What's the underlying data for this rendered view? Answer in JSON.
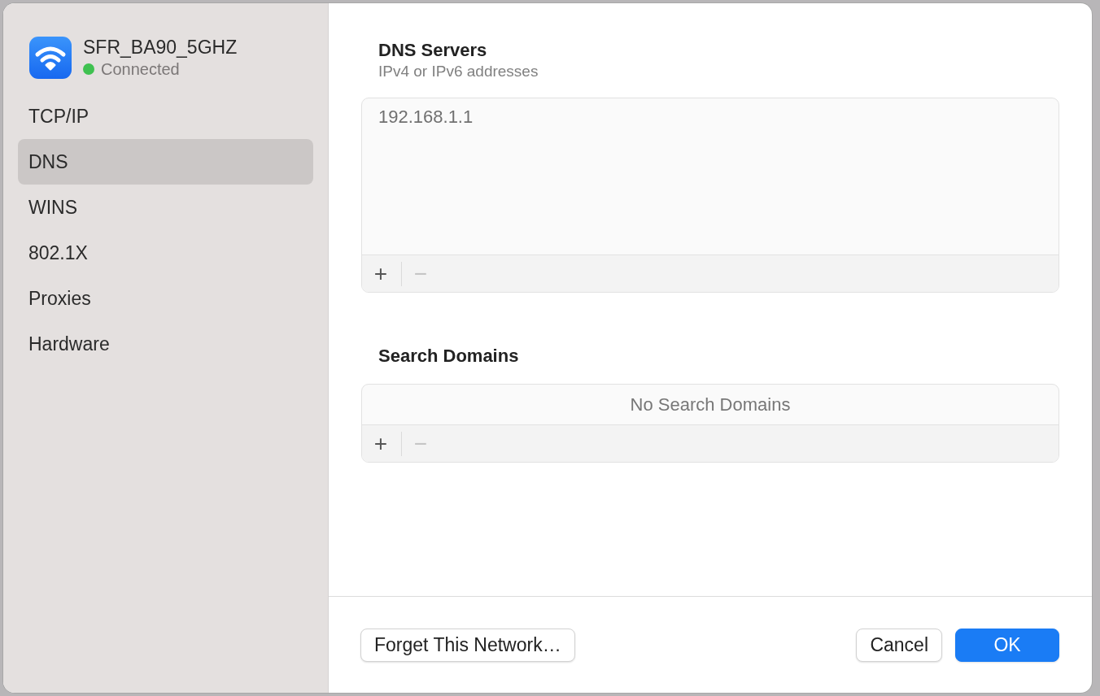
{
  "network": {
    "name": "SFR_BA90_5GHZ",
    "status": {
      "text": "Connected",
      "color": "#3fc150"
    }
  },
  "sidebar": {
    "items": [
      {
        "label": "TCP/IP",
        "selected": false
      },
      {
        "label": "DNS",
        "selected": true
      },
      {
        "label": "WINS",
        "selected": false
      },
      {
        "label": "802.1X",
        "selected": false
      },
      {
        "label": "Proxies",
        "selected": false
      },
      {
        "label": "Hardware",
        "selected": false
      }
    ]
  },
  "dns_servers": {
    "title": "DNS Servers",
    "subtitle": "IPv4 or IPv6 addresses",
    "entries": [
      "192.168.1.1"
    ],
    "add": {
      "label": "+",
      "disabled": false
    },
    "remove": {
      "label": "−",
      "disabled": true
    }
  },
  "search_domains": {
    "title": "Search Domains",
    "empty_text": "No Search Domains",
    "add": {
      "label": "+",
      "disabled": false
    },
    "remove": {
      "label": "−",
      "disabled": true
    }
  },
  "buttons": [
    {
      "label": "Forget This Network…",
      "kind": "secondary"
    },
    {
      "label": "Cancel",
      "kind": "secondary"
    },
    {
      "label": "OK",
      "kind": "primary"
    }
  ]
}
